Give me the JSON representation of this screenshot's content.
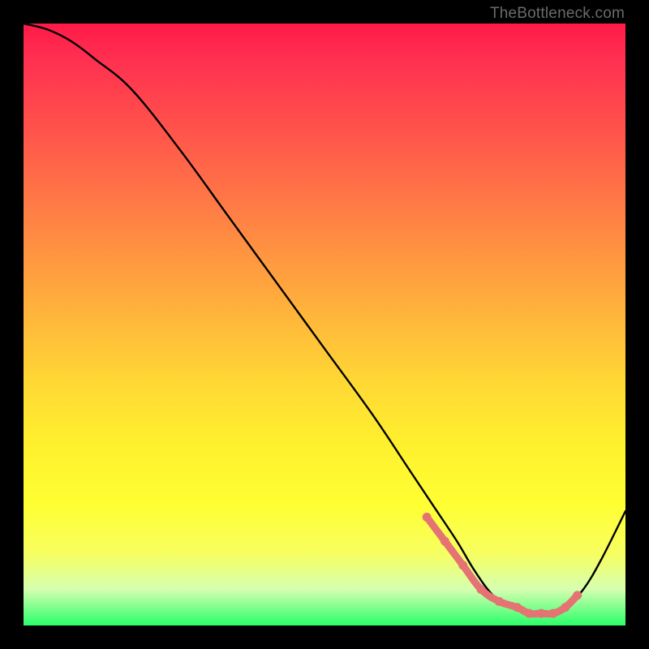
{
  "watermark": "TheBottleneck.com",
  "chart_data": {
    "type": "line",
    "title": "",
    "xlabel": "",
    "ylabel": "",
    "xlim": [
      0,
      100
    ],
    "ylim": [
      0,
      100
    ],
    "series": [
      {
        "name": "curve",
        "x": [
          0,
          4,
          8,
          12,
          18,
          26,
          34,
          42,
          50,
          58,
          64,
          68,
          72,
          75,
          78,
          81,
          84,
          87,
          90,
          93,
          96,
          100
        ],
        "y": [
          100,
          99,
          97,
          94,
          89,
          79,
          68,
          57,
          46,
          35,
          26,
          20,
          14,
          9,
          5,
          3,
          2,
          2,
          3,
          6,
          11,
          19
        ]
      }
    ],
    "markers": {
      "name": "highlight",
      "color": "#e57373",
      "x": [
        67,
        70,
        73,
        76,
        79,
        82,
        84,
        86,
        88,
        90,
        92
      ],
      "y": [
        18,
        14,
        10,
        6,
        4,
        3,
        2,
        2,
        2,
        3,
        5
      ]
    },
    "background_gradient_note": "vertical gradient red→orange→yellow→green"
  }
}
